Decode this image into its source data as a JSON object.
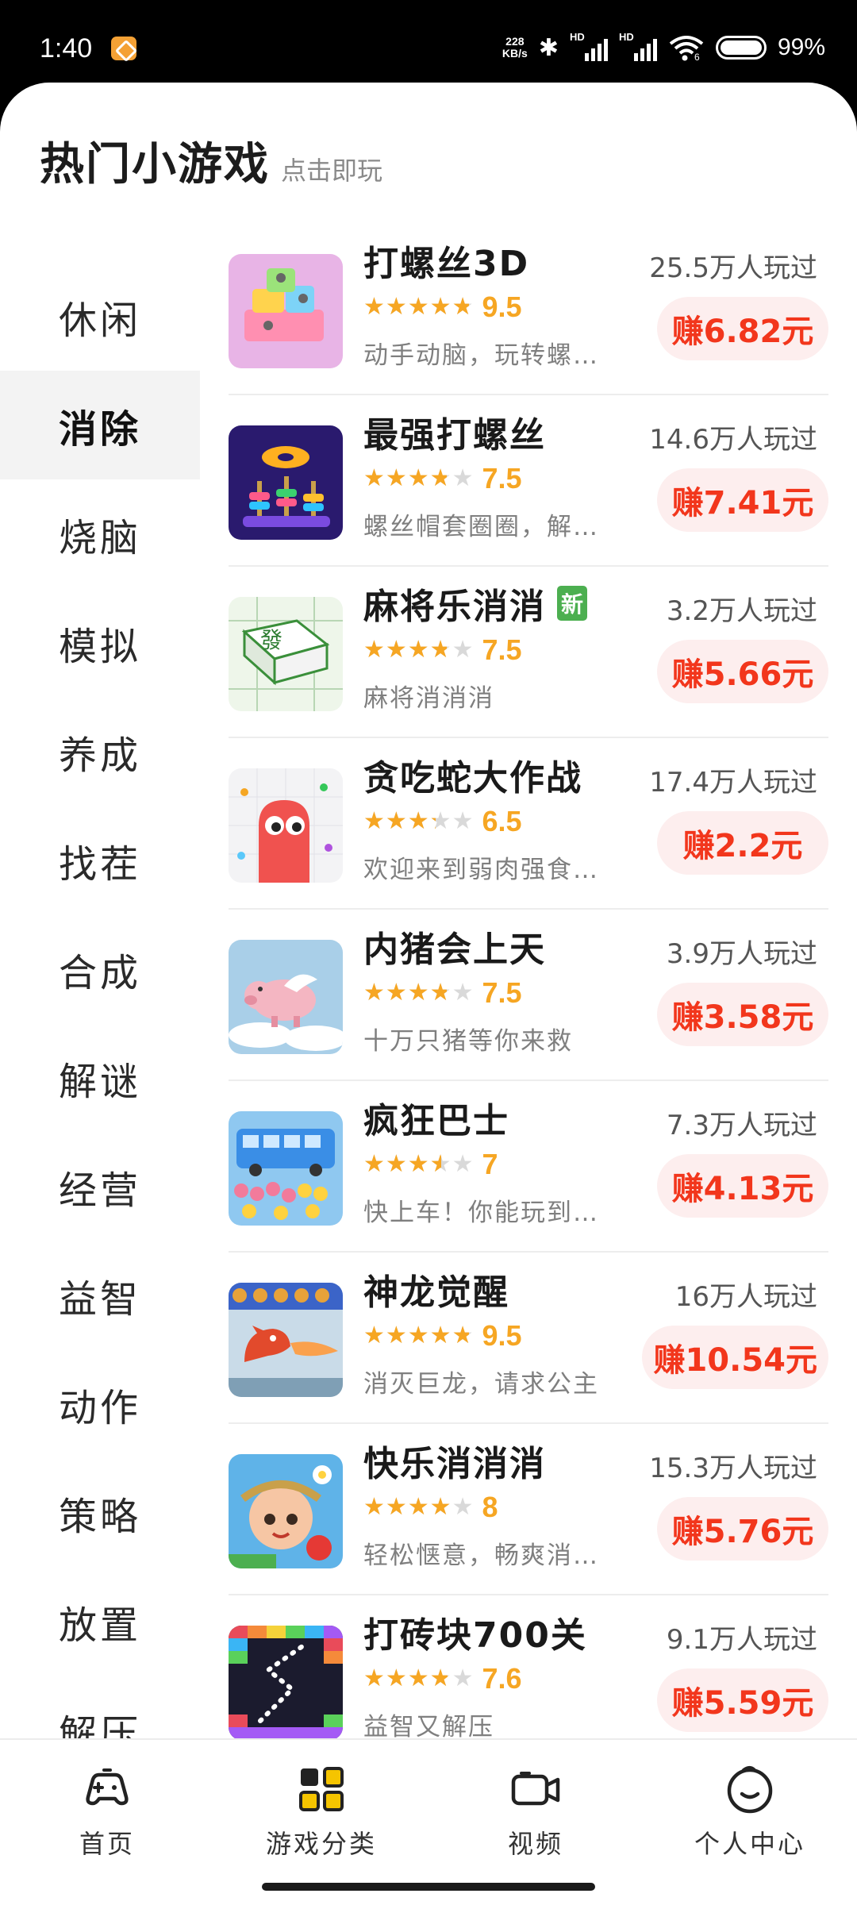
{
  "status_bar": {
    "time": "1:40",
    "speed_value": "228",
    "speed_unit": "KB/s",
    "signal1_label": "HD",
    "signal2_label": "HD",
    "wifi_label": "6",
    "battery": "99%"
  },
  "header": {
    "title": "热门小游戏",
    "subtitle": "点击即玩"
  },
  "categories": [
    {
      "label": "休闲",
      "active": false
    },
    {
      "label": "消除",
      "active": true
    },
    {
      "label": "烧脑",
      "active": false
    },
    {
      "label": "模拟",
      "active": false
    },
    {
      "label": "养成",
      "active": false
    },
    {
      "label": "找茬",
      "active": false
    },
    {
      "label": "合成",
      "active": false
    },
    {
      "label": "解谜",
      "active": false
    },
    {
      "label": "经营",
      "active": false
    },
    {
      "label": "益智",
      "active": false
    },
    {
      "label": "动作",
      "active": false
    },
    {
      "label": "策略",
      "active": false
    },
    {
      "label": "放置",
      "active": false
    },
    {
      "label": "解压",
      "active": false
    }
  ],
  "games": [
    {
      "name": "打螺丝3D",
      "score": "9.5",
      "desc": "动手动脑，玩转螺…",
      "players": "25.5万人玩过",
      "reward": "赚6.82元",
      "is_new": false
    },
    {
      "name": "最强打螺丝",
      "score": "7.5",
      "desc": "螺丝帽套圈圈，解…",
      "players": "14.6万人玩过",
      "reward": "赚7.41元",
      "is_new": false
    },
    {
      "name": "麻将乐消消",
      "score": "7.5",
      "desc": "麻将消消消",
      "players": "3.2万人玩过",
      "reward": "赚5.66元",
      "is_new": true,
      "new_label": "新"
    },
    {
      "name": "贪吃蛇大作战",
      "score": "6.5",
      "desc": "欢迎来到弱肉强食…",
      "players": "17.4万人玩过",
      "reward": "赚2.2元",
      "is_new": false
    },
    {
      "name": "内猪会上天",
      "score": "7.5",
      "desc": "十万只猪等你来救",
      "players": "3.9万人玩过",
      "reward": "赚3.58元",
      "is_new": false
    },
    {
      "name": "疯狂巴士",
      "score": "7",
      "desc": "快上车！你能玩到…",
      "players": "7.3万人玩过",
      "reward": "赚4.13元",
      "is_new": false
    },
    {
      "name": "神龙觉醒",
      "score": "9.5",
      "desc": "消灭巨龙，请求公主",
      "players": "16万人玩过",
      "reward": "赚10.54元",
      "is_new": false
    },
    {
      "name": "快乐消消消",
      "score": "8",
      "desc": "轻松惬意，畅爽消…",
      "players": "15.3万人玩过",
      "reward": "赚5.76元",
      "is_new": false
    },
    {
      "name": "打砖块700关",
      "score": "7.6",
      "desc": "益智又解压",
      "players": "9.1万人玩过",
      "reward": "赚5.59元",
      "is_new": false
    }
  ],
  "tabs": [
    {
      "label": "首页",
      "icon": "gamepad-icon"
    },
    {
      "label": "游戏分类",
      "icon": "grid-icon"
    },
    {
      "label": "视频",
      "icon": "video-camera-icon"
    },
    {
      "label": "个人中心",
      "icon": "smile-face-icon"
    }
  ],
  "colors": {
    "accent_red": "#f2361c",
    "reward_bg": "#fdeeee",
    "star": "#f6a623",
    "active_tab_yellow": "#f5c400",
    "new_badge": "#4caf50"
  }
}
